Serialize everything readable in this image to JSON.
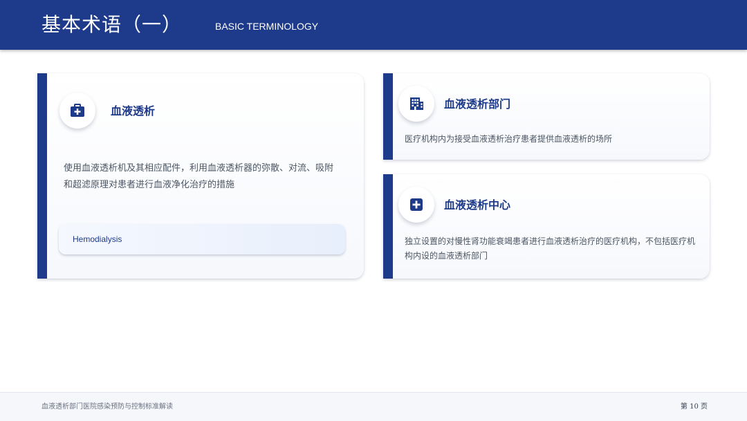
{
  "header": {
    "title": "基本术语（一）",
    "subtitle": "BASIC TERMINOLOGY",
    "color": "#1e3a8a"
  },
  "cards": [
    {
      "icon": "medical-kit-icon",
      "title": "血液透析",
      "description": "使用血液透析机及其相应配件，利用血液透析器的弥散、对流、吸附和超滤原理对患者进行血液净化治疗的措施",
      "english": "Hemodialysis"
    },
    {
      "icon": "hospital-building-icon",
      "title": "血液透析部门",
      "description": "医疗机构内为接受血液透析治疗患者提供血液透析的场所"
    },
    {
      "icon": "medical-cross-icon",
      "title": "血液透析中心",
      "description": "独立设置的对慢性肾功能衰竭患者进行血液透析治疗的医疗机构，不包括医疗机构内设的血液透析部门"
    }
  ],
  "footer": {
    "left": "血液透析部门医院感染预防与控制标准解读",
    "page": "第 10 页"
  }
}
